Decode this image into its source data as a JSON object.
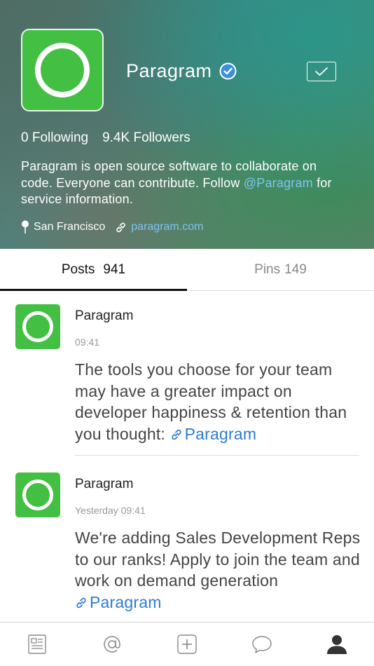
{
  "profile": {
    "name": "Paragram",
    "following": "0 Following",
    "followers": "9.4K Followers",
    "bio_before": "Paragram is open source software to collaborate on code. Everyone can contribute. Follow ",
    "bio_mention": "@Paragram",
    "bio_after": " for service information.",
    "location": "San Francisco",
    "website": "paragram.com",
    "verified_icon": "verified-badge-icon",
    "follow_state_icon": "check-icon"
  },
  "tabs": [
    {
      "label": "Posts",
      "count": "941",
      "active": true
    },
    {
      "label": "Pins",
      "count": "149",
      "active": false
    }
  ],
  "posts": [
    {
      "author": "Paragram",
      "time": "09:41",
      "text": "The tools you choose for your team may have a greater impact on developer happiness & retention than you thought: ",
      "link": "Paragram"
    },
    {
      "author": "Paragram",
      "time": "Yesterday 09:41",
      "text": "We're adding Sales Development Reps to our ranks! Apply to join the team and work on demand generation ",
      "link": "Paragram"
    }
  ],
  "tabbar": [
    "news-icon",
    "mention-icon",
    "compose-icon",
    "messages-icon",
    "profile-icon"
  ],
  "colors": {
    "brand_green": "#43c043",
    "link_blue": "#2b7cd3",
    "light_link": "#7ec4f0"
  }
}
